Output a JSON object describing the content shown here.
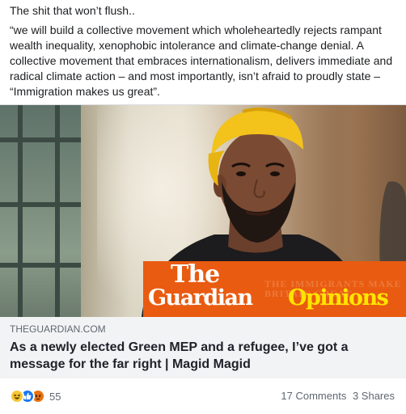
{
  "post": {
    "text_line1": "The shit that won’t flush..",
    "text_quote": "“we will build a collective movement which wholeheartedly rejects rampant wealth inequality, xenophobic intolerance and climate-change denial. A collective movement that embraces internationalism, delivers immediate and radical climate action – and most importantly, isn’t afraid to proudly state – “Immigration makes us great”."
  },
  "link_card": {
    "brand_the": "The",
    "brand_guardian": "Guardian",
    "brand_opinions": "Opinions",
    "domain": "THEGUARDIAN.COM",
    "headline": "As a newly elected Green MEP and a refugee, I’ve got a message for the far right | Magid Magid",
    "colors": {
      "brand_orange": "#e95b10",
      "opinions_yellow": "#ffe500"
    }
  },
  "footer": {
    "reaction_icons": [
      "haha-icon",
      "like-icon",
      "angry-icon"
    ],
    "reaction_count": "55",
    "comments": "17 Comments",
    "shares": "3 Shares"
  }
}
